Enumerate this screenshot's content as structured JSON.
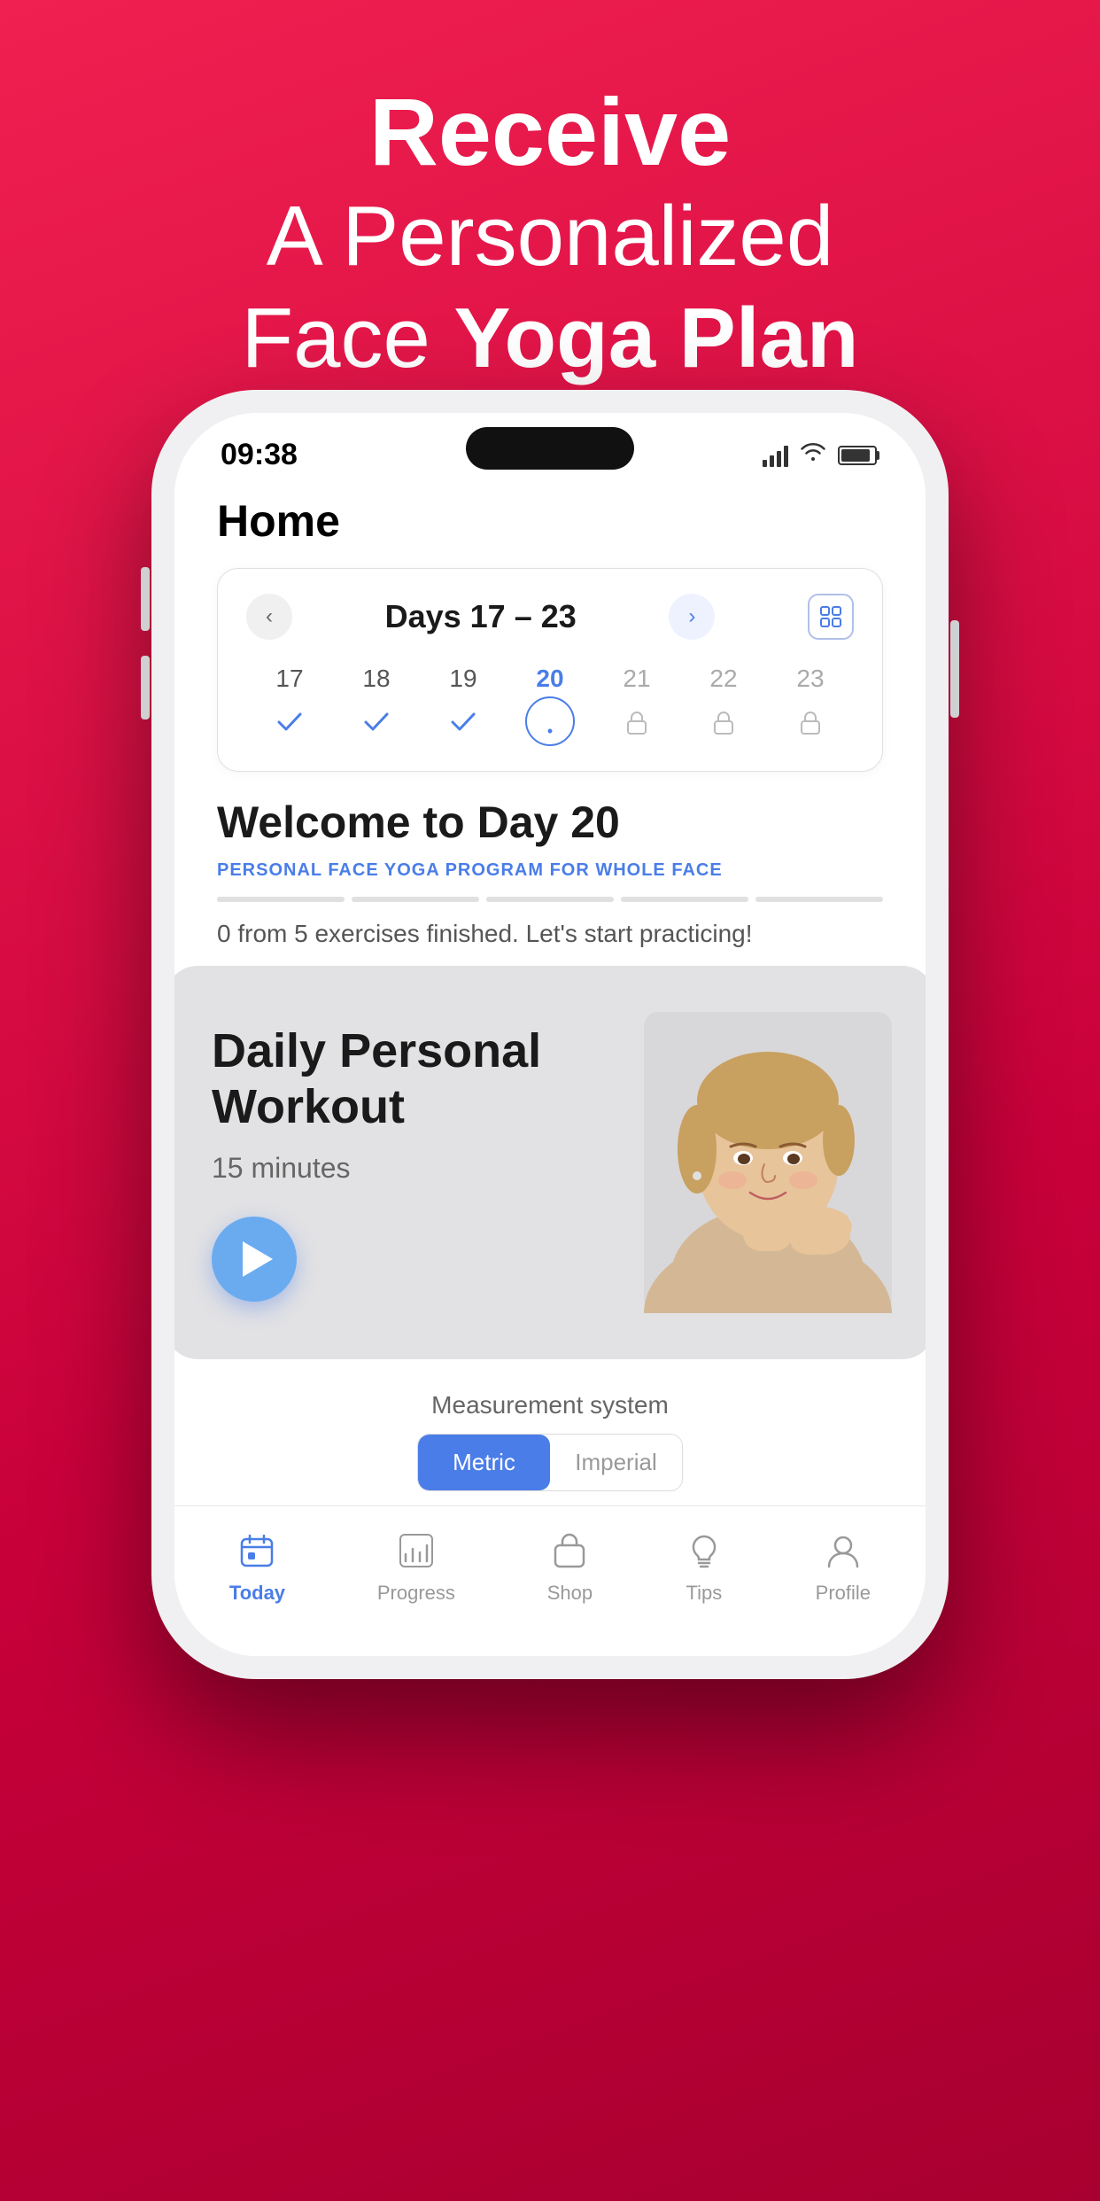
{
  "hero": {
    "line1": "Receive",
    "line2": "A Personalized",
    "line3_plain": "Face ",
    "line3_bold": "Yoga Plan"
  },
  "status_bar": {
    "time": "09:38"
  },
  "home": {
    "title": "Home"
  },
  "calendar": {
    "range": "Days 17 – 23",
    "days": [
      {
        "num": "17",
        "state": "check"
      },
      {
        "num": "18",
        "state": "check"
      },
      {
        "num": "19",
        "state": "check"
      },
      {
        "num": "20",
        "state": "active"
      },
      {
        "num": "21",
        "state": "lock"
      },
      {
        "num": "22",
        "state": "lock"
      },
      {
        "num": "23",
        "state": "lock"
      }
    ]
  },
  "welcome": {
    "title": "Welcome to Day 20",
    "program_tag": "PERSONAL FACE YOGA PROGRAM FOR WHOLE FACE",
    "exercise_count": "0 from 5 exercises finished. Let's start practicing!"
  },
  "workout_card": {
    "title_line1": "Daily Personal",
    "title_line2": "Workout",
    "duration": "15 minutes"
  },
  "measurement": {
    "label": "Measurement system",
    "options": [
      "Metric",
      "Imperial"
    ],
    "selected": "Metric"
  },
  "bottom_nav": {
    "items": [
      {
        "label": "Today",
        "active": true,
        "icon": "calendar"
      },
      {
        "label": "Progress",
        "active": false,
        "icon": "chart"
      },
      {
        "label": "Shop",
        "active": false,
        "icon": "bag"
      },
      {
        "label": "Tips",
        "active": false,
        "icon": "lightbulb"
      },
      {
        "label": "Profile",
        "active": false,
        "icon": "person"
      }
    ]
  },
  "colors": {
    "accent_blue": "#4a7de8",
    "bg_gradient_start": "#f02050",
    "bg_gradient_end": "#a80030",
    "card_bg": "#e4e4e6"
  }
}
